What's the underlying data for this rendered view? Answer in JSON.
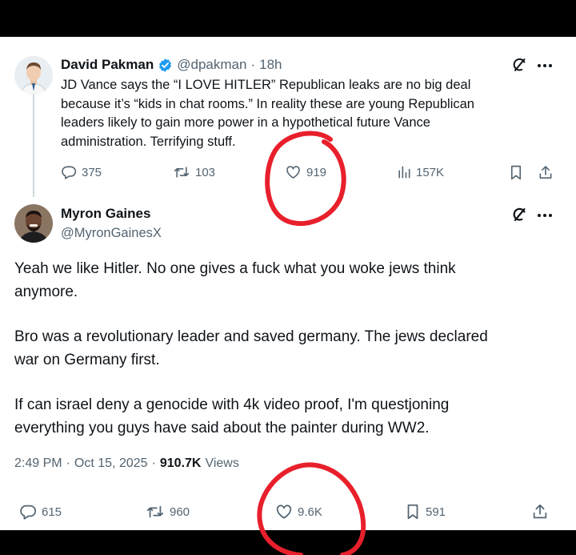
{
  "tweet1": {
    "author_name": "David Pakman",
    "handle": "@dpakman",
    "separator": "·",
    "time": "18h",
    "text_lines": [
      "JD Vance says the “I LOVE HITLER” Republican leaks are no big deal",
      "because it’s “kids in chat rooms.” In reality these are young Republican",
      "leaders likely to gain more power in a hypothetical future Vance",
      "administration. Terrifying stuff."
    ],
    "stats": {
      "replies": "375",
      "reposts": "103",
      "likes": "919",
      "views": "157K"
    }
  },
  "tweet2": {
    "author_name": "Myron Gaines",
    "handle": "@MyronGainesX",
    "paragraphs": [
      [
        "Yeah we like Hitler. No one gives a fuck what you woke jews think",
        "anymore."
      ],
      [
        "Bro was a revolutionary leader and saved germany. The jews declared",
        "war on Germany first."
      ],
      [
        "If can israel deny a genocide with 4k video proof, I'm questjoning",
        "everything you guys have said about the painter during WW2."
      ]
    ],
    "meta": {
      "time": "2:49 PM",
      "sep1": "·",
      "date": "Oct 15, 2025",
      "sep2": "·",
      "views_count": "910.7K",
      "views_label": "Views"
    },
    "stats": {
      "replies": "615",
      "reposts": "960",
      "likes": "9.6K",
      "bookmarks": "591"
    }
  },
  "colors": {
    "verified": "#1d9bf0",
    "muted": "#536471",
    "annotation": "#e8202c",
    "frame": "#000000"
  },
  "icons": [
    "verified-badge-icon",
    "grok-icon",
    "more-icon",
    "reply-icon",
    "repost-icon",
    "like-icon",
    "views-icon",
    "bookmark-icon",
    "share-icon"
  ]
}
